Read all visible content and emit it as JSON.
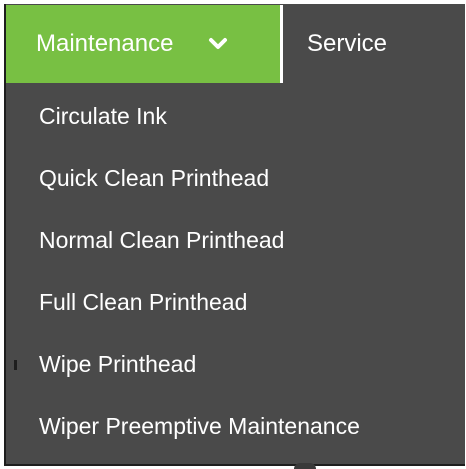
{
  "colors": {
    "accent": "#78c043",
    "menu_bg": "#4a4a4a",
    "text": "#ffffff",
    "divider": "#ffffff"
  },
  "navbar": {
    "tabs": [
      {
        "label": "Maintenance",
        "active": true,
        "icon": "chevron-down-icon"
      },
      {
        "label": "Service",
        "active": false
      }
    ]
  },
  "dropdown": {
    "items": [
      {
        "label": "Circulate Ink"
      },
      {
        "label": "Quick Clean Printhead"
      },
      {
        "label": "Normal Clean Printhead"
      },
      {
        "label": "Full Clean Printhead"
      },
      {
        "label": "Wipe Printhead"
      },
      {
        "label": "Wiper Preemptive Maintenance"
      }
    ]
  }
}
